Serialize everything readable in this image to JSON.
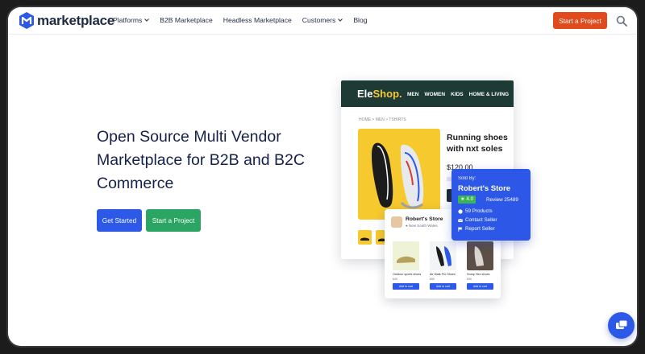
{
  "nav": {
    "logo_text": "marketplace",
    "menu": [
      {
        "label": "Platforms",
        "has_dropdown": true
      },
      {
        "label": "B2B Marketplace",
        "has_dropdown": false
      },
      {
        "label": "Headless Marketplace",
        "has_dropdown": false
      },
      {
        "label": "Customers",
        "has_dropdown": true
      },
      {
        "label": "Blog",
        "has_dropdown": false
      }
    ],
    "cta_label": "Start a Project",
    "search_icon": "search-icon"
  },
  "hero": {
    "title_lines": [
      "Open Source Multi Vendor",
      "Marketplace for B2B and B2C",
      "Commerce"
    ],
    "primary_button": "Get Started",
    "secondary_button": "Start a Project"
  },
  "illustration": {
    "brand_main": "Ele",
    "brand_accent": "Shop.",
    "shop_nav": [
      "MEN",
      "WOMEN",
      "KIDS",
      "HOME & LIVING"
    ],
    "breadcrumb": "HOME >   MEN >   TSHIRTS",
    "product_title": "Running shoes with nxt soles",
    "product_price": "$120.00",
    "seller": {
      "sold_by": "Sold By:",
      "name": "Robert's Store",
      "rating": "★ 4.0",
      "reviews": "Review 25489",
      "products": "59 Products",
      "contact": "Contact Seller",
      "report": "Report Seller"
    },
    "store": {
      "name": "Robert's Store",
      "location": "New South Wales",
      "products": [
        {
          "name": "Outdoor sports shoes",
          "price": "$49",
          "button": "Add to cart"
        },
        {
          "name": "Air Walk Pro Shoes",
          "price": "$59",
          "button": "Add to cart"
        },
        {
          "name": "Hump Hen shoes",
          "price": "$39",
          "button": "Add to cart"
        }
      ]
    }
  },
  "colors": {
    "brand_navy": "#1f2a44",
    "cta_orange": "#e04a1d",
    "primary_blue": "#2c59e8",
    "secondary_green": "#2aa563",
    "shop_header": "#1d3a34",
    "product_yellow": "#f6c92e"
  }
}
